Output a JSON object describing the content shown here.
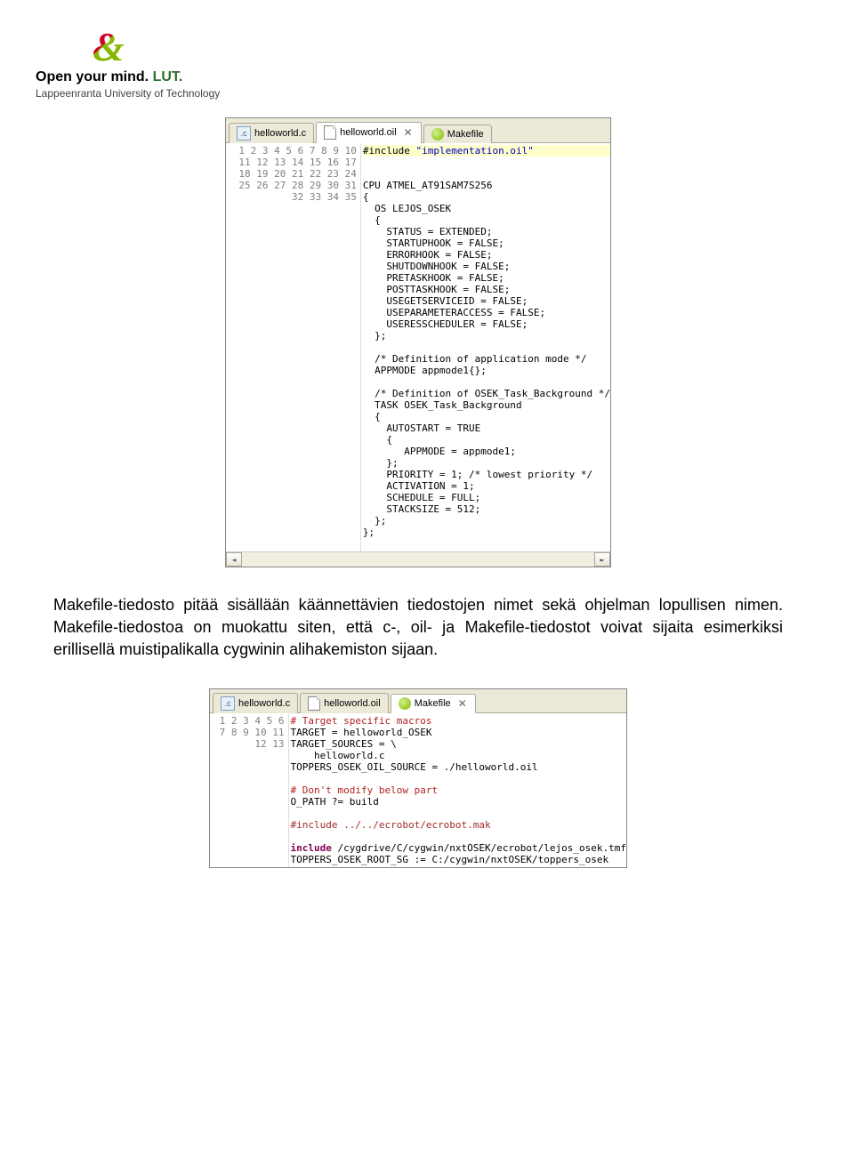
{
  "logo": {
    "amp": "&",
    "tagline_open": "Open your mind.",
    "tagline_lut": " LUT.",
    "university": "Lappeenranta University of Technology"
  },
  "shot1": {
    "tabs": [
      {
        "icon": "c",
        "label": "helloworld.c",
        "active": false,
        "closeable": false
      },
      {
        "icon": "file",
        "label": "helloworld.oil",
        "active": true,
        "closeable": true
      },
      {
        "icon": "makefile",
        "label": "Makefile",
        "active": false,
        "closeable": false
      }
    ],
    "lines": [
      {
        "n": 1,
        "hl": true,
        "text": "#include \"implementation.oil\"",
        "class": ""
      },
      {
        "n": 2,
        "text": ""
      },
      {
        "n": 3,
        "text": "CPU ATMEL_AT91SAM7S256"
      },
      {
        "n": 4,
        "text": "{"
      },
      {
        "n": 5,
        "text": "  OS LEJOS_OSEK"
      },
      {
        "n": 6,
        "text": "  {"
      },
      {
        "n": 7,
        "text": "    STATUS = EXTENDED;"
      },
      {
        "n": 8,
        "text": "    STARTUPHOOK = FALSE;"
      },
      {
        "n": 9,
        "text": "    ERRORHOOK = FALSE;"
      },
      {
        "n": 10,
        "text": "    SHUTDOWNHOOK = FALSE;"
      },
      {
        "n": 11,
        "text": "    PRETASKHOOK = FALSE;"
      },
      {
        "n": 12,
        "text": "    POSTTASKHOOK = FALSE;"
      },
      {
        "n": 13,
        "text": "    USEGETSERVICEID = FALSE;"
      },
      {
        "n": 14,
        "text": "    USEPARAMETERACCESS = FALSE;"
      },
      {
        "n": 15,
        "text": "    USERESSCHEDULER = FALSE;"
      },
      {
        "n": 16,
        "text": "  };"
      },
      {
        "n": 17,
        "text": ""
      },
      {
        "n": 18,
        "text": "  /* Definition of application mode */"
      },
      {
        "n": 19,
        "text": "  APPMODE appmode1{};"
      },
      {
        "n": 20,
        "text": ""
      },
      {
        "n": 21,
        "text": "  /* Definition of OSEK_Task_Background */"
      },
      {
        "n": 22,
        "text": "  TASK OSEK_Task_Background"
      },
      {
        "n": 23,
        "text": "  {"
      },
      {
        "n": 24,
        "text": "    AUTOSTART = TRUE"
      },
      {
        "n": 25,
        "text": "    {"
      },
      {
        "n": 26,
        "text": "       APPMODE = appmode1;"
      },
      {
        "n": 27,
        "text": "    };"
      },
      {
        "n": 28,
        "text": "    PRIORITY = 1; /* lowest priority */"
      },
      {
        "n": 29,
        "text": "    ACTIVATION = 1;"
      },
      {
        "n": 30,
        "text": "    SCHEDULE = FULL;"
      },
      {
        "n": 31,
        "text": "    STACKSIZE = 512;"
      },
      {
        "n": 32,
        "text": "  };"
      },
      {
        "n": 33,
        "text": "};"
      },
      {
        "n": 34,
        "text": ""
      },
      {
        "n": 35,
        "text": ""
      }
    ]
  },
  "paragraph": "Makefile-tiedosto pitää sisällään käännettävien tiedostojen nimet sekä ohjelman lopullisen nimen. Makefile-tiedostoa on muokattu siten, että c-, oil- ja Makefile-tiedostot voivat sijaita esimerkiksi erillisellä muistipalikalla cygwinin alihakemiston sijaan.",
  "shot2": {
    "tabs": [
      {
        "icon": "c",
        "label": "helloworld.c",
        "active": false,
        "closeable": false
      },
      {
        "icon": "file",
        "label": "helloworld.oil",
        "active": false,
        "closeable": false
      },
      {
        "icon": "makefile",
        "label": "Makefile",
        "active": true,
        "closeable": true
      }
    ],
    "lines": [
      {
        "n": 1,
        "html": "<span class='mk-cm'># Target specific macros</span>"
      },
      {
        "n": 2,
        "html": "TARGET = helloworld_OSEK"
      },
      {
        "n": 3,
        "html": "TARGET_SOURCES = \\"
      },
      {
        "n": 4,
        "html": "    helloworld.c"
      },
      {
        "n": 5,
        "html": "TOPPERS_OSEK_OIL_SOURCE = ./helloworld.oil"
      },
      {
        "n": 6,
        "html": ""
      },
      {
        "n": 7,
        "html": "<span class='mk-cm'># Don't modify below part</span>"
      },
      {
        "n": 8,
        "html": "O_PATH ?= build"
      },
      {
        "n": 9,
        "html": ""
      },
      {
        "n": 10,
        "html": "<span class='mk-inc'>#include ../../ecrobot/ecrobot.mak</span>"
      },
      {
        "n": 11,
        "html": ""
      },
      {
        "n": 12,
        "html": "<span class='kw'>include</span> /cygdrive/C/cygwin/nxtOSEK/ecrobot/lejos_osek.tmf"
      },
      {
        "n": 13,
        "html": "TOPPERS_OSEK_ROOT_SG := C:/cygwin/nxtOSEK/toppers_osek"
      }
    ]
  }
}
